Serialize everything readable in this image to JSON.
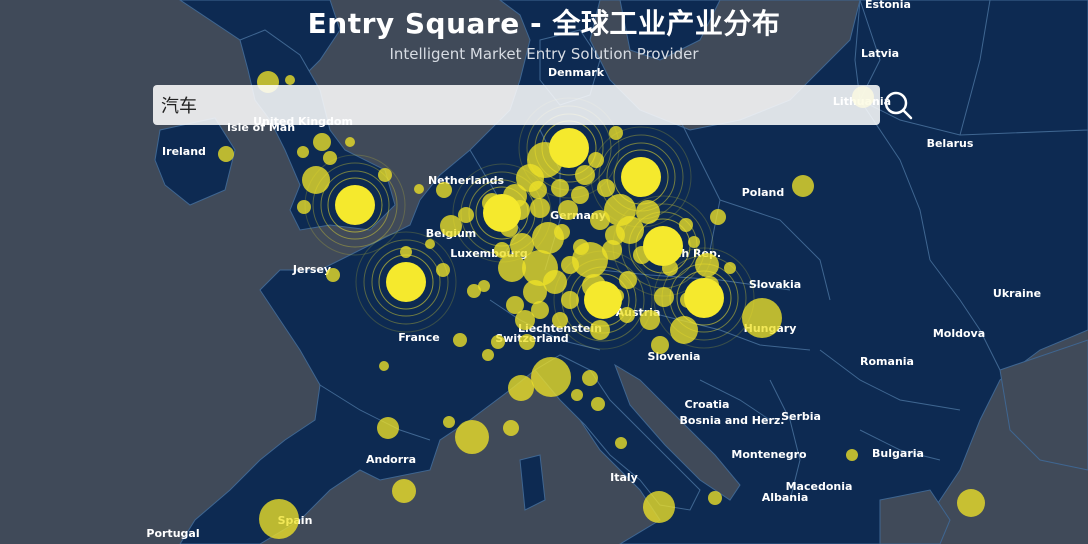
{
  "title": "Entry Square - 全球工业产业分布",
  "subtitle": "Intelligent Market Entry Solution Provider",
  "search": {
    "value": "汽车",
    "icon": "search-icon"
  },
  "colors": {
    "sea": "#404a59",
    "land": "#0d2a52",
    "border": "#3f6691",
    "marker": "#f5e92d",
    "marker_alpha": "rgba(238,225,40,0.78)"
  },
  "country_labels": [
    {
      "name": "Estonia"
    },
    {
      "name": "Latvia"
    },
    {
      "name": "Denmark"
    },
    {
      "name": "Lithuania"
    },
    {
      "name": "United Kingdom"
    },
    {
      "name": "Isle of Man"
    },
    {
      "name": "Ireland"
    },
    {
      "name": "Belarus"
    },
    {
      "name": "Netherlands"
    },
    {
      "name": "Poland"
    },
    {
      "name": "Germany"
    },
    {
      "name": "Belgium"
    },
    {
      "name": "Luxembourg"
    },
    {
      "name": "Czech Rep."
    },
    {
      "name": "Jersey"
    },
    {
      "name": "Slovakia"
    },
    {
      "name": "Ukraine"
    },
    {
      "name": "Austria"
    },
    {
      "name": "Liechtenstein"
    },
    {
      "name": "Hungary"
    },
    {
      "name": "France"
    },
    {
      "name": "Switzerland"
    },
    {
      "name": "Moldova"
    },
    {
      "name": "Slovenia"
    },
    {
      "name": "Romania"
    },
    {
      "name": "Croatia"
    },
    {
      "name": "Bosnia and Herz."
    },
    {
      "name": "Serbia"
    },
    {
      "name": "Montenegro"
    },
    {
      "name": "Bulgaria"
    },
    {
      "name": "Andorra"
    },
    {
      "name": "Italy"
    },
    {
      "name": "Macedonia"
    },
    {
      "name": "Albania"
    },
    {
      "name": "Spain"
    },
    {
      "name": "Portugal"
    }
  ]
}
